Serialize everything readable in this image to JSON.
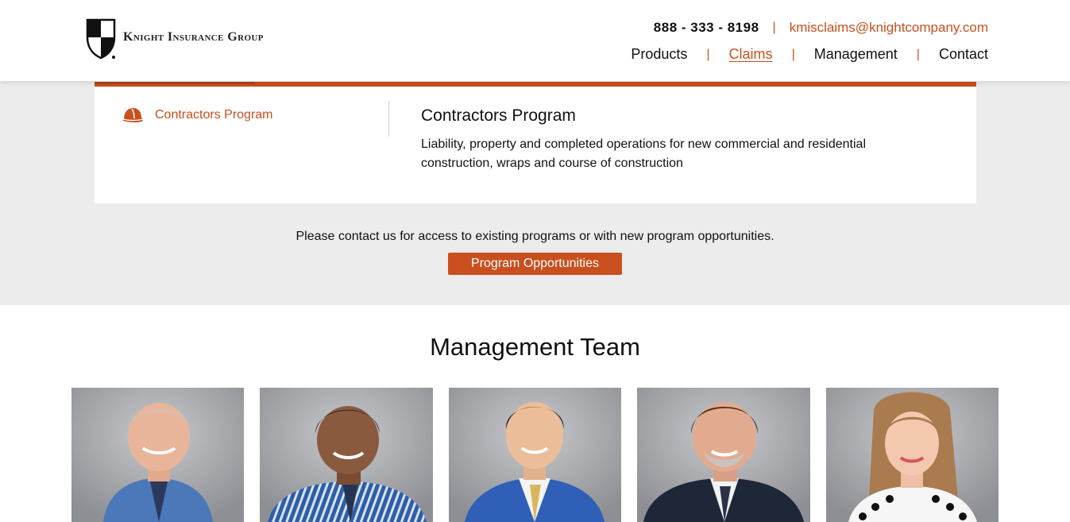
{
  "header": {
    "logo_text": "Knight Insurance Group",
    "phone": "888 - 333 - 8198",
    "separator": "|",
    "email": "kmisclaims@knightcompany.com",
    "nav": [
      {
        "label": "Products",
        "active": false
      },
      {
        "label": "Claims",
        "active": true
      },
      {
        "label": "Management",
        "active": false
      },
      {
        "label": "Contact",
        "active": false
      }
    ]
  },
  "program": {
    "tab_label": "Contractors Program",
    "title": "Contractors Program",
    "description": "Liability, property and completed operations for new commercial and residential construction, wraps and course of construction",
    "icon": "hard-hat-icon"
  },
  "contact_note": "Please contact us for access to existing programs or with new program opportunities.",
  "cta_label": "Program Opportunities",
  "team": {
    "title": "Management Team"
  },
  "colors": {
    "accent": "#c9501e",
    "panel_bg": "#ececec"
  }
}
